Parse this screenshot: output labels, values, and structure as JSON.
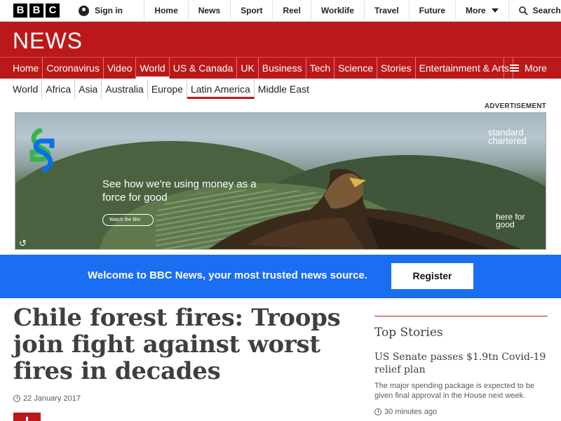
{
  "topbar": {
    "logo_letters": [
      "B",
      "B",
      "C"
    ],
    "signin_label": "Sign in",
    "nav": [
      "Home",
      "News",
      "Sport",
      "Reel",
      "Worklife",
      "Travel",
      "Future"
    ],
    "more_label": "More",
    "search_label": "Search"
  },
  "header": {
    "title": "NEWS",
    "nav": [
      "Home",
      "Coronavirus",
      "Video",
      "World",
      "US & Canada",
      "UK",
      "Business",
      "Tech",
      "Science",
      "Stories",
      "Entertainment & Arts"
    ],
    "active_nav": "World",
    "more_label": "More",
    "accent_color": "#bb1919"
  },
  "subnav": {
    "items": [
      "World",
      "Africa",
      "Asia",
      "Australia",
      "Europe",
      "Latin America",
      "Middle East"
    ],
    "active": "Latin America"
  },
  "advert": {
    "label": "ADVERTISEMENT",
    "brand_line1": "standard",
    "brand_line2": "chartered",
    "tagline": "See how we're using money as a force for good",
    "watch_label": "Watch the film",
    "here_for": "here for good"
  },
  "register_banner": {
    "message": "Welcome to BBC News, your most trusted news source.",
    "button_label": "Register",
    "color": "#1a6ef2"
  },
  "article": {
    "headline": "Chile forest fires: Troops join fight against worst fires in decades",
    "date": "22 January 2017"
  },
  "sidebar": {
    "heading": "Top Stories",
    "story": {
      "title": "US Senate passes $1.9tn Covid-19 relief plan",
      "summary": "The major spending package is expected to be given final approval in the House next week.",
      "time": "30 minutes ago"
    }
  }
}
